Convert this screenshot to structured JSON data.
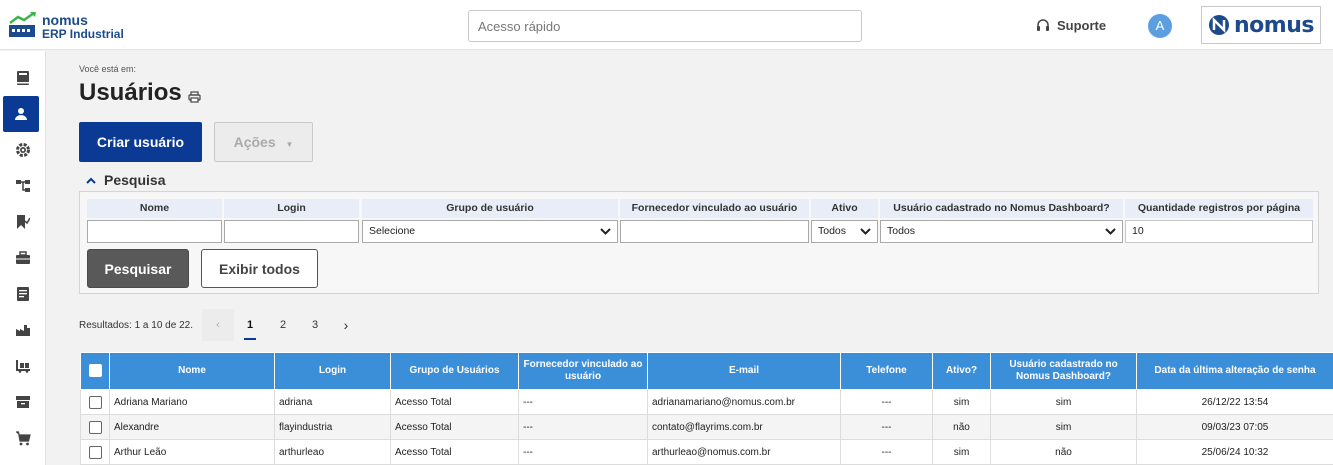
{
  "header": {
    "logo_line1": "nomus",
    "logo_line2": "ERP Industrial",
    "quick_access_placeholder": "Acesso rápido",
    "support_label": "Suporte",
    "avatar_letter": "A",
    "brand": "nomus"
  },
  "sidebar": {
    "items": [
      {
        "icon": "book-icon"
      },
      {
        "icon": "user-icon",
        "active": true
      },
      {
        "icon": "gear-icon"
      },
      {
        "icon": "hierarchy-icon"
      },
      {
        "icon": "bookmark-check-icon"
      },
      {
        "icon": "briefcase-icon"
      },
      {
        "icon": "ledger-icon"
      },
      {
        "icon": "factory-icon"
      },
      {
        "icon": "forklift-icon"
      },
      {
        "icon": "archive-icon"
      },
      {
        "icon": "cart-icon"
      }
    ]
  },
  "page": {
    "breadcrumb_label": "Você está em:",
    "title": "Usuários",
    "create_button": "Criar usuário",
    "actions_button": "Ações"
  },
  "search": {
    "heading": "Pesquisa",
    "labels": {
      "name": "Nome",
      "login": "Login",
      "group": "Grupo de usuário",
      "supplier": "Fornecedor vinculado ao usuário",
      "active": "Ativo",
      "dashboard": "Usuário cadastrado no Nomus Dashboard?",
      "page_size": "Quantidade registros por página"
    },
    "values": {
      "name": "",
      "login": "",
      "group": "Selecione",
      "supplier": "",
      "active": "Todos",
      "dashboard": "Todos",
      "page_size": "10"
    },
    "search_button": "Pesquisar",
    "show_all_button": "Exibir todos"
  },
  "pagination": {
    "results_text": "Resultados: 1 a 10 de 22.",
    "prev": "‹",
    "pages": [
      "1",
      "2",
      "3"
    ],
    "next": "›",
    "current": "1"
  },
  "table": {
    "headers": [
      "Nome",
      "Login",
      "Grupo de Usuários",
      "Fornecedor vinculado ao usuário",
      "E-mail",
      "Telefone",
      "Ativo?",
      "Usuário cadastrado no Nomus Dashboard?",
      "Data da última alteração de senha"
    ],
    "rows": [
      [
        "Adriana Mariano",
        "adriana",
        "Acesso Total",
        "---",
        "adrianamariano@nomus.com.br",
        "---",
        "sim",
        "sim",
        "26/12/22 13:54"
      ],
      [
        "Alexandre",
        "flayindustria",
        "Acesso Total",
        "---",
        "contato@flayrims.com.br",
        "---",
        "não",
        "sim",
        "09/03/23 07:05"
      ],
      [
        "Arthur Leão",
        "arthurleao",
        "Acesso Total",
        "---",
        "arthurleao@nomus.com.br",
        "---",
        "sim",
        "não",
        "25/06/24 10:32"
      ]
    ]
  },
  "colors": {
    "primary": "#0a3a93",
    "table_header": "#3b8fd9",
    "avatar": "#5b9fe0"
  }
}
